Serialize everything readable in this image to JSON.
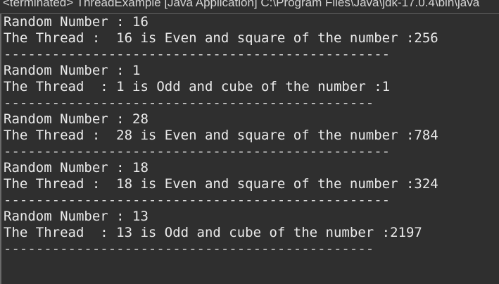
{
  "window": {
    "title": "<terminated> ThreadExample [Java Application] C:\\Program Files\\Java\\jdk-17.0.4\\bin\\java"
  },
  "console": {
    "blocks": [
      {
        "random": "Random Number : 16",
        "result": "The Thread :  16 is Even and square of the number :256",
        "separator": "------------------------------------------------"
      },
      {
        "random": "Random Number : 1",
        "result": "The Thread  : 1 is Odd and cube of the number :1",
        "separator": "----------------------------------------------"
      },
      {
        "random": "Random Number : 28",
        "result": "The Thread :  28 is Even and square of the number :784",
        "separator": "------------------------------------------------"
      },
      {
        "random": "Random Number : 18",
        "result": "The Thread :  18 is Even and square of the number :324",
        "separator": "------------------------------------------------"
      },
      {
        "random": "Random Number : 13",
        "result": "The Thread  : 13 is Odd and cube of the number :2197",
        "separator": "----------------------------------------------"
      }
    ]
  }
}
